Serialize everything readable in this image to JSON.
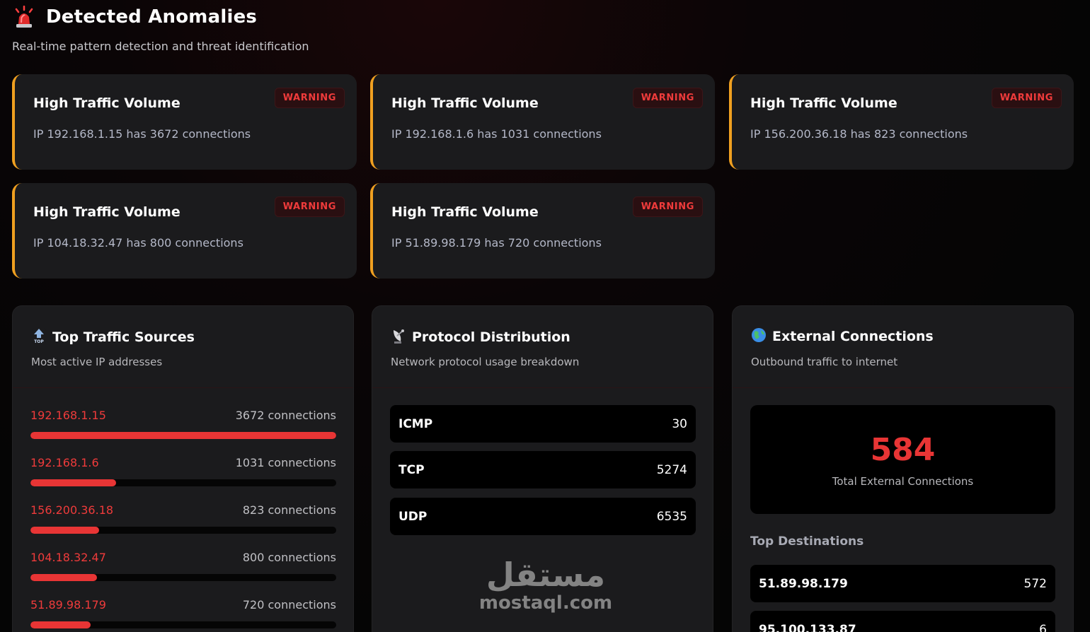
{
  "header": {
    "icon": "siren-icon",
    "title": "Detected Anomalies",
    "subtitle": "Real-time pattern detection and threat identification"
  },
  "anomalies": [
    {
      "title": "High Traffic Volume",
      "description": "IP 192.168.1.15 has 3672 connections",
      "severity": "WARNING"
    },
    {
      "title": "High Traffic Volume",
      "description": "IP 192.168.1.6 has 1031 connections",
      "severity": "WARNING"
    },
    {
      "title": "High Traffic Volume",
      "description": "IP 156.200.36.18 has 823 connections",
      "severity": "WARNING"
    },
    {
      "title": "High Traffic Volume",
      "description": "IP 104.18.32.47 has 800 connections",
      "severity": "WARNING"
    },
    {
      "title": "High Traffic Volume",
      "description": "IP 51.89.98.179 has 720 connections",
      "severity": "WARNING"
    }
  ],
  "top_sources": {
    "icon": "top-arrow-icon",
    "title": "Top Traffic Sources",
    "subtitle": "Most active IP addresses",
    "items": [
      {
        "ip": "192.168.1.15",
        "count_label": "3672 connections",
        "fraction": 1.0
      },
      {
        "ip": "192.168.1.6",
        "count_label": "1031 connections",
        "fraction": 0.281
      },
      {
        "ip": "156.200.36.18",
        "count_label": "823 connections",
        "fraction": 0.224
      },
      {
        "ip": "104.18.32.47",
        "count_label": "800 connections",
        "fraction": 0.218
      },
      {
        "ip": "51.89.98.179",
        "count_label": "720 connections",
        "fraction": 0.196
      }
    ]
  },
  "protocols": {
    "icon": "satellite-dish-icon",
    "title": "Protocol Distribution",
    "subtitle": "Network protocol usage breakdown",
    "items": [
      {
        "name": "ICMP",
        "value": "30"
      },
      {
        "name": "TCP",
        "value": "5274"
      },
      {
        "name": "UDP",
        "value": "6535"
      }
    ]
  },
  "external": {
    "icon": "globe-icon",
    "title": "External Connections",
    "subtitle": "Outbound traffic to internet",
    "total": "584",
    "total_label": "Total External Connections",
    "destinations_title": "Top Destinations",
    "destinations": [
      {
        "ip": "51.89.98.179",
        "value": "572"
      },
      {
        "ip": "95.100.133.87",
        "value": "6"
      }
    ]
  },
  "watermark": {
    "arabic": "مستقل",
    "latin": "mostaql.com"
  },
  "colors": {
    "accent_red": "#e83535",
    "warning_border": "#f0a020",
    "card_bg": "#1b1b1d"
  }
}
